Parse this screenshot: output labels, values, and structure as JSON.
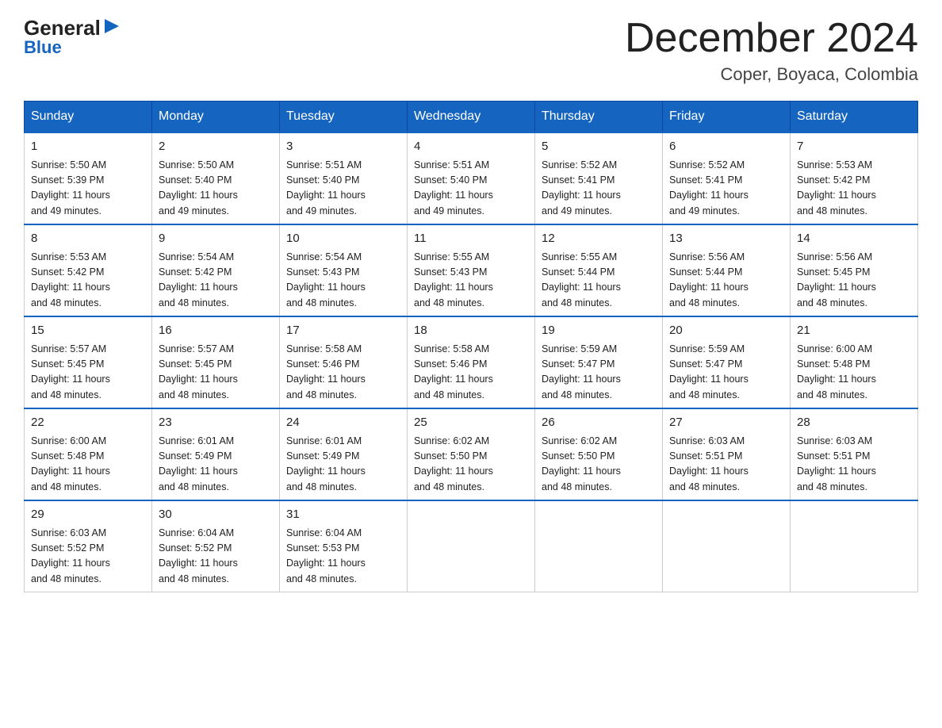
{
  "logo": {
    "general": "General",
    "triangle": "▶",
    "blue": "Blue"
  },
  "title": {
    "month_year": "December 2024",
    "location": "Coper, Boyaca, Colombia"
  },
  "weekdays": [
    "Sunday",
    "Monday",
    "Tuesday",
    "Wednesday",
    "Thursday",
    "Friday",
    "Saturday"
  ],
  "weeks": [
    [
      {
        "day": 1,
        "sunrise": "5:50 AM",
        "sunset": "5:39 PM",
        "daylight": "11 hours and 49 minutes."
      },
      {
        "day": 2,
        "sunrise": "5:50 AM",
        "sunset": "5:40 PM",
        "daylight": "11 hours and 49 minutes."
      },
      {
        "day": 3,
        "sunrise": "5:51 AM",
        "sunset": "5:40 PM",
        "daylight": "11 hours and 49 minutes."
      },
      {
        "day": 4,
        "sunrise": "5:51 AM",
        "sunset": "5:40 PM",
        "daylight": "11 hours and 49 minutes."
      },
      {
        "day": 5,
        "sunrise": "5:52 AM",
        "sunset": "5:41 PM",
        "daylight": "11 hours and 49 minutes."
      },
      {
        "day": 6,
        "sunrise": "5:52 AM",
        "sunset": "5:41 PM",
        "daylight": "11 hours and 49 minutes."
      },
      {
        "day": 7,
        "sunrise": "5:53 AM",
        "sunset": "5:42 PM",
        "daylight": "11 hours and 48 minutes."
      }
    ],
    [
      {
        "day": 8,
        "sunrise": "5:53 AM",
        "sunset": "5:42 PM",
        "daylight": "11 hours and 48 minutes."
      },
      {
        "day": 9,
        "sunrise": "5:54 AM",
        "sunset": "5:42 PM",
        "daylight": "11 hours and 48 minutes."
      },
      {
        "day": 10,
        "sunrise": "5:54 AM",
        "sunset": "5:43 PM",
        "daylight": "11 hours and 48 minutes."
      },
      {
        "day": 11,
        "sunrise": "5:55 AM",
        "sunset": "5:43 PM",
        "daylight": "11 hours and 48 minutes."
      },
      {
        "day": 12,
        "sunrise": "5:55 AM",
        "sunset": "5:44 PM",
        "daylight": "11 hours and 48 minutes."
      },
      {
        "day": 13,
        "sunrise": "5:56 AM",
        "sunset": "5:44 PM",
        "daylight": "11 hours and 48 minutes."
      },
      {
        "day": 14,
        "sunrise": "5:56 AM",
        "sunset": "5:45 PM",
        "daylight": "11 hours and 48 minutes."
      }
    ],
    [
      {
        "day": 15,
        "sunrise": "5:57 AM",
        "sunset": "5:45 PM",
        "daylight": "11 hours and 48 minutes."
      },
      {
        "day": 16,
        "sunrise": "5:57 AM",
        "sunset": "5:45 PM",
        "daylight": "11 hours and 48 minutes."
      },
      {
        "day": 17,
        "sunrise": "5:58 AM",
        "sunset": "5:46 PM",
        "daylight": "11 hours and 48 minutes."
      },
      {
        "day": 18,
        "sunrise": "5:58 AM",
        "sunset": "5:46 PM",
        "daylight": "11 hours and 48 minutes."
      },
      {
        "day": 19,
        "sunrise": "5:59 AM",
        "sunset": "5:47 PM",
        "daylight": "11 hours and 48 minutes."
      },
      {
        "day": 20,
        "sunrise": "5:59 AM",
        "sunset": "5:47 PM",
        "daylight": "11 hours and 48 minutes."
      },
      {
        "day": 21,
        "sunrise": "6:00 AM",
        "sunset": "5:48 PM",
        "daylight": "11 hours and 48 minutes."
      }
    ],
    [
      {
        "day": 22,
        "sunrise": "6:00 AM",
        "sunset": "5:48 PM",
        "daylight": "11 hours and 48 minutes."
      },
      {
        "day": 23,
        "sunrise": "6:01 AM",
        "sunset": "5:49 PM",
        "daylight": "11 hours and 48 minutes."
      },
      {
        "day": 24,
        "sunrise": "6:01 AM",
        "sunset": "5:49 PM",
        "daylight": "11 hours and 48 minutes."
      },
      {
        "day": 25,
        "sunrise": "6:02 AM",
        "sunset": "5:50 PM",
        "daylight": "11 hours and 48 minutes."
      },
      {
        "day": 26,
        "sunrise": "6:02 AM",
        "sunset": "5:50 PM",
        "daylight": "11 hours and 48 minutes."
      },
      {
        "day": 27,
        "sunrise": "6:03 AM",
        "sunset": "5:51 PM",
        "daylight": "11 hours and 48 minutes."
      },
      {
        "day": 28,
        "sunrise": "6:03 AM",
        "sunset": "5:51 PM",
        "daylight": "11 hours and 48 minutes."
      }
    ],
    [
      {
        "day": 29,
        "sunrise": "6:03 AM",
        "sunset": "5:52 PM",
        "daylight": "11 hours and 48 minutes."
      },
      {
        "day": 30,
        "sunrise": "6:04 AM",
        "sunset": "5:52 PM",
        "daylight": "11 hours and 48 minutes."
      },
      {
        "day": 31,
        "sunrise": "6:04 AM",
        "sunset": "5:53 PM",
        "daylight": "11 hours and 48 minutes."
      },
      null,
      null,
      null,
      null
    ]
  ]
}
